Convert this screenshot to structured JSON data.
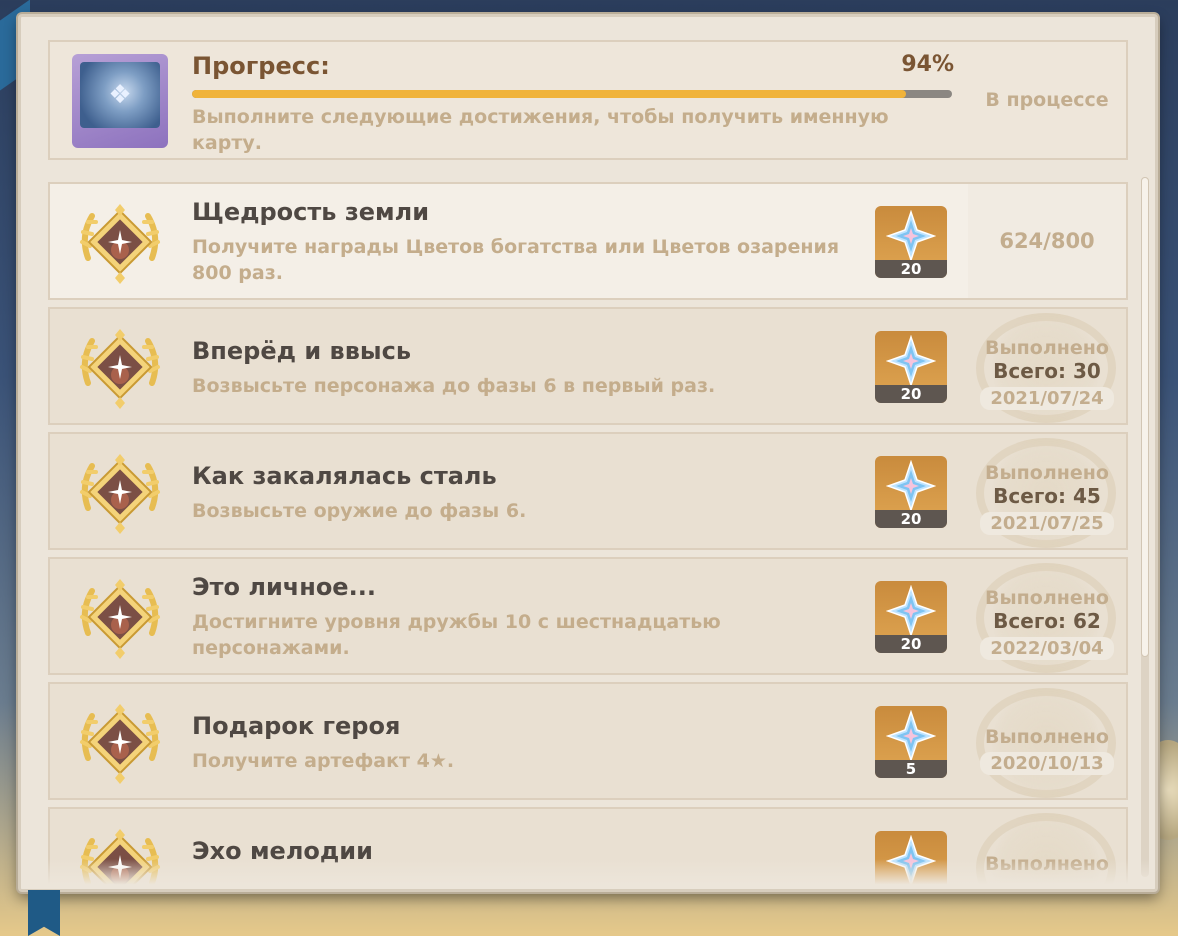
{
  "progress": {
    "title": "Прогресс:",
    "percent_label": "94%",
    "percent_value": 94,
    "description": "Выполните следующие достижения, чтобы получить именную карту.",
    "status": "В процессе",
    "card_icon": "namecard-icon"
  },
  "achievements": [
    {
      "title": "Щедрость земли",
      "description": "Получите награды Цветов богатства или Цветов озарения 800 раз.",
      "reward_icon": "primogem-icon",
      "reward_count": "20",
      "state": "in-progress",
      "progress_text": "624/800"
    },
    {
      "title": "Вперёд и ввысь",
      "description": "Возвысьте персонажа до фазы 6 в первый раз.",
      "reward_icon": "primogem-icon",
      "reward_count": "20",
      "state": "done",
      "status_text": "Выполнено",
      "total_text": "Всего: 30",
      "date": "2021/07/24"
    },
    {
      "title": "Как закалялась сталь",
      "description": "Возвысьте оружие до фазы 6.",
      "reward_icon": "primogem-icon",
      "reward_count": "20",
      "state": "done",
      "status_text": "Выполнено",
      "total_text": "Всего: 45",
      "date": "2021/07/25"
    },
    {
      "title": "Это личное...",
      "description": "Достигните уровня дружбы 10 с шестнадцатью персонажами.",
      "reward_icon": "primogem-icon",
      "reward_count": "20",
      "state": "done",
      "status_text": "Выполнено",
      "total_text": "Всего: 62",
      "date": "2022/03/04"
    },
    {
      "title": "Подарок героя",
      "description": "Получите артефакт 4★.",
      "reward_icon": "primogem-icon",
      "reward_count": "5",
      "state": "done",
      "status_text": "Выполнено",
      "total_text": "",
      "date": "2020/10/13"
    },
    {
      "title": "Эхо мелодии",
      "description": "",
      "reward_icon": "primogem-icon",
      "reward_count": "",
      "state": "done",
      "status_text": "Выполнено",
      "total_text": "",
      "date": ""
    }
  ],
  "colors": {
    "accent": "#f0b33a",
    "title_brown": "#7a5533",
    "muted_text": "#c4ad8c"
  }
}
